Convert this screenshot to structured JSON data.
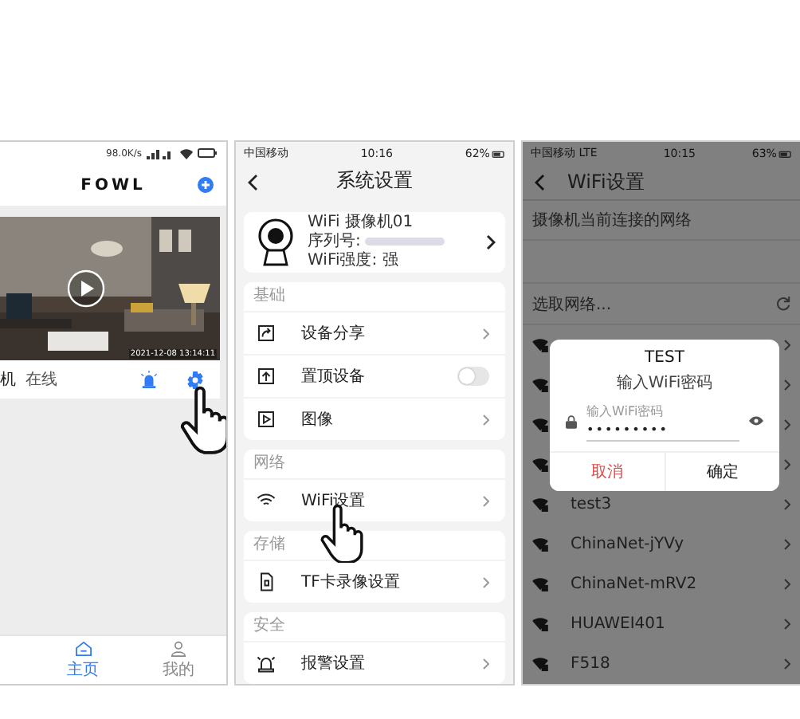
{
  "home_screen": {
    "status_bar": {
      "speed": "98.0K/s"
    },
    "logo": "FOWL",
    "camera": {
      "timestamp": "2021-12-08 13:14:11",
      "name": "机",
      "status": "在线"
    },
    "tabs": [
      {
        "label": "主页",
        "selected": true
      },
      {
        "label": "我的",
        "selected": false
      }
    ]
  },
  "settings_screen": {
    "status_bar": {
      "carrier": "中国移动",
      "time": "10:16",
      "battery": "62%"
    },
    "title": "系统设置",
    "device": {
      "name": "WiFi 摄像机01",
      "serial_label": "序列号:",
      "signal": "WiFi强度: 强"
    },
    "sections": [
      {
        "header": "基础",
        "items": [
          {
            "label": "设备分享",
            "kind": "link"
          },
          {
            "label": "置顶设备",
            "kind": "toggle",
            "on": false
          },
          {
            "label": "图像",
            "kind": "link"
          }
        ]
      },
      {
        "header": "网络",
        "items": [
          {
            "label": "WiFi设置",
            "kind": "link"
          }
        ]
      },
      {
        "header": "存储",
        "items": [
          {
            "label": "TF卡录像设置",
            "kind": "link"
          }
        ]
      },
      {
        "header": "安全",
        "items": [
          {
            "label": "报警设置",
            "kind": "link"
          }
        ]
      }
    ]
  },
  "wifi_screen": {
    "status_bar": {
      "carrier": "中国移动",
      "network": "LTE",
      "time": "10:15",
      "battery": "63%"
    },
    "title": "WiFi设置",
    "current_label": "摄像机当前连接的网络",
    "choose_label": "选取网络...",
    "networks": [
      {
        "name": "test3"
      },
      {
        "name": "ChinaNet-jYVy"
      },
      {
        "name": "ChinaNet-mRV2"
      },
      {
        "name": "HUAWEI401"
      },
      {
        "name": "F518"
      }
    ],
    "dialog": {
      "title": "TEST",
      "subtitle": "输入WiFi密码",
      "field": {
        "label": "输入WiFi密码",
        "value": "•••••••••"
      },
      "buttons": [
        {
          "label": "取消",
          "kind": "cancel"
        },
        {
          "label": "确定",
          "kind": "confirm"
        }
      ]
    }
  }
}
